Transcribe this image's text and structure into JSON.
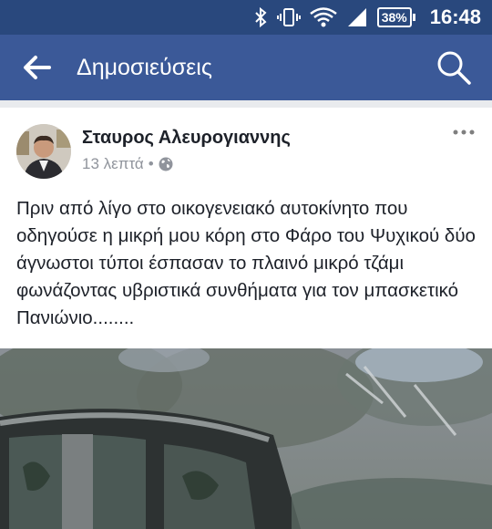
{
  "status_bar": {
    "battery": "38%",
    "time": "16:48",
    "icons": [
      "bluetooth-icon",
      "vibrate-icon",
      "wifi-icon",
      "cell-signal-icon",
      "battery-icon"
    ]
  },
  "app_bar": {
    "title": "Δημοσιεύσεις",
    "icons": [
      "back-arrow-icon",
      "search-icon"
    ],
    "color": "#3b5998"
  },
  "post": {
    "author": "Σταυρος Αλευρογιαννης",
    "time": "13 λεπτά",
    "separator": "•",
    "privacy_icon": "globe-icon",
    "text": "Πριν από λίγο στο οικογενειακό αυτοκίνητο που οδηγούσε η μικρή μου κόρη στο Φάρο του Ψυχικού δύο άγνωστοι τύποι έσπασαν το πλαινό μικρό τζάμι φωνάζοντας υβριστικά συνθήματα για τον μπασκετικό Πανιώνιο........",
    "more_icon": "more-options-icon"
  }
}
